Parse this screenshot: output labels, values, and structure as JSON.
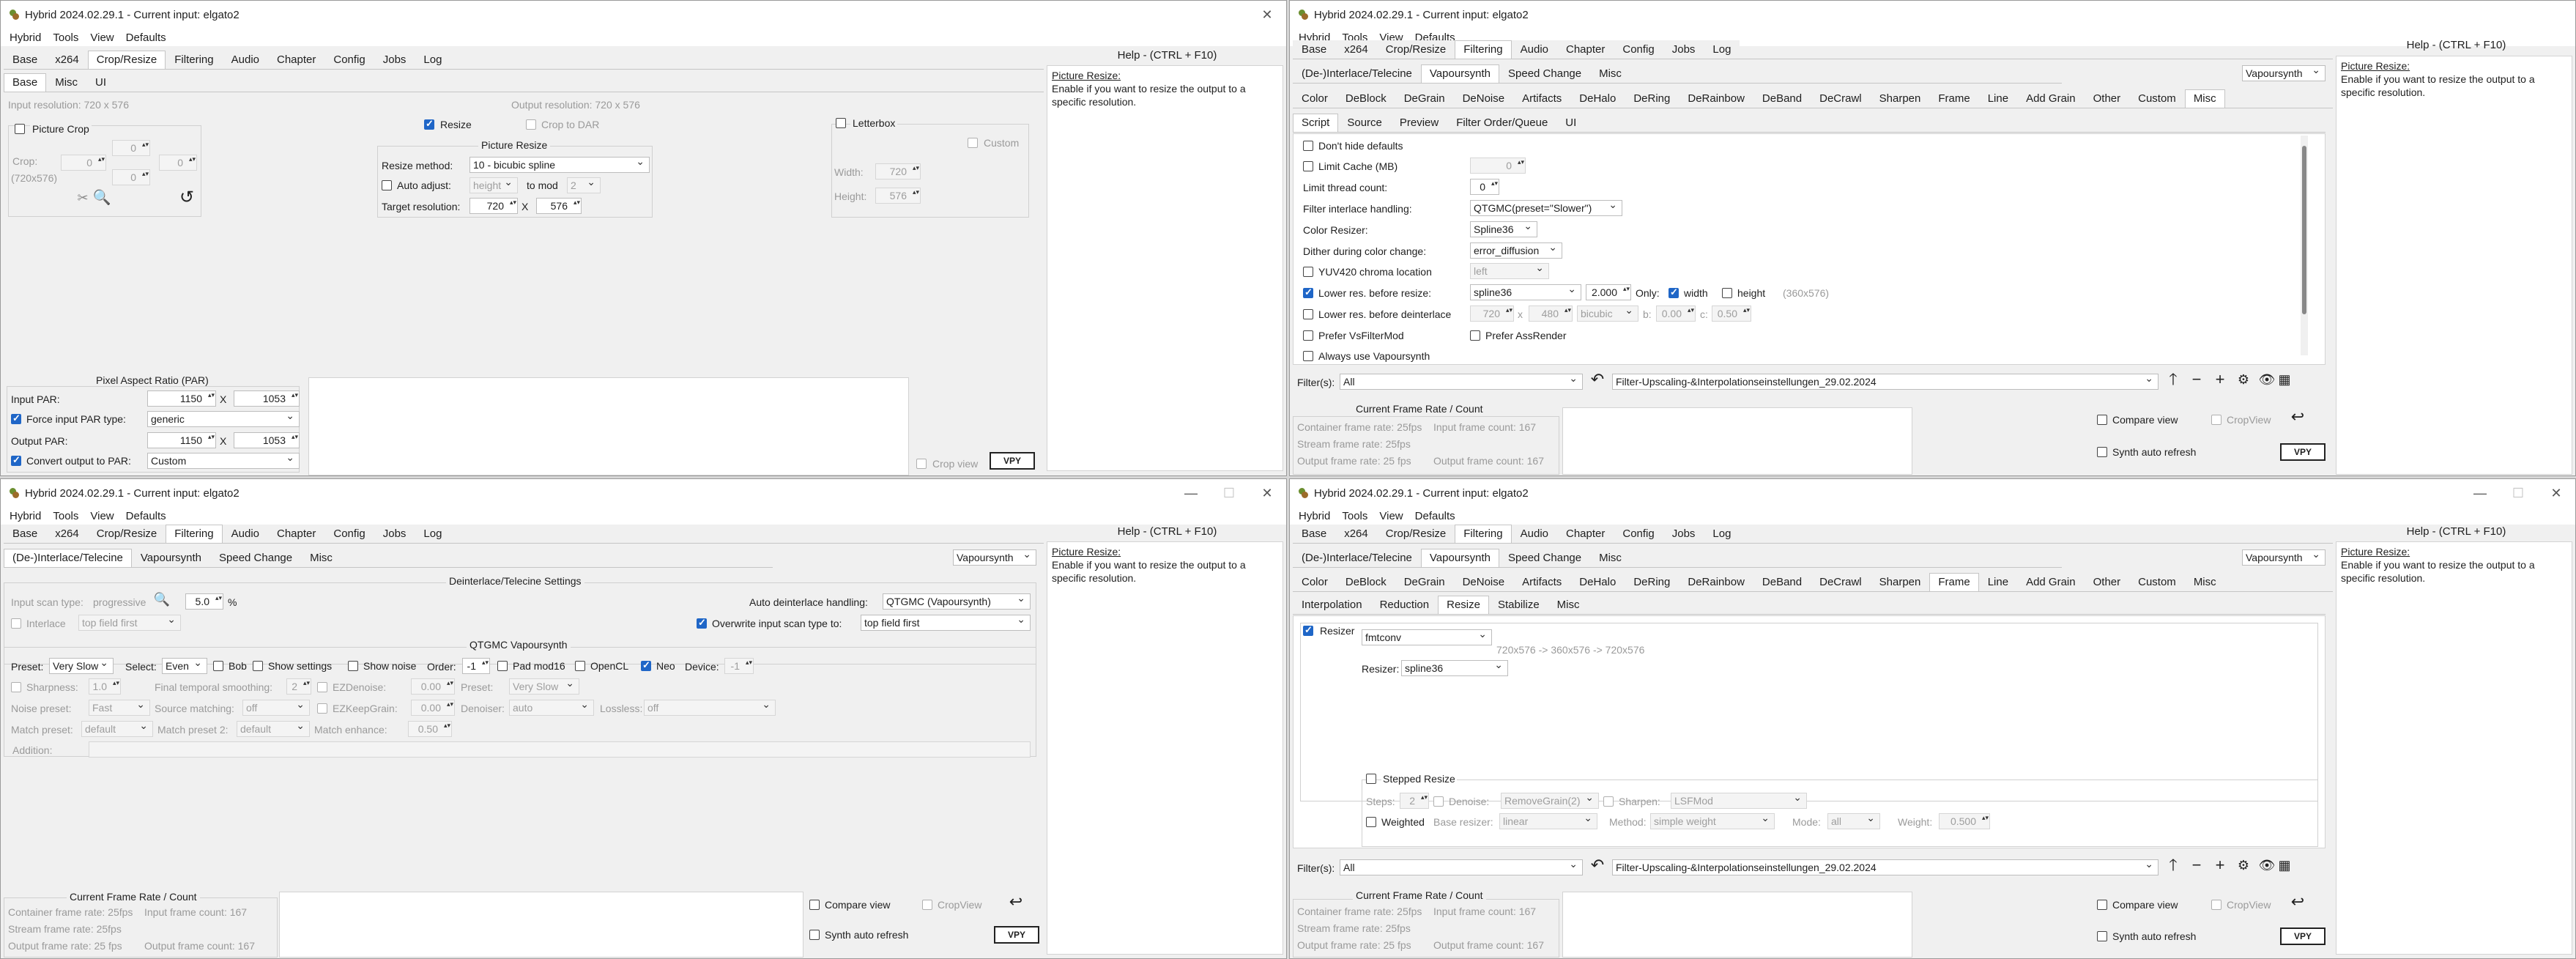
{
  "title": "Hybrid 2024.02.29.1 - Current input: elgato2",
  "menus": [
    "Hybrid",
    "Tools",
    "View",
    "Defaults"
  ],
  "main_tabs": [
    "Base",
    "x264",
    "Crop/Resize",
    "Filtering",
    "Audio",
    "Chapter",
    "Config",
    "Jobs",
    "Log"
  ],
  "help_title": "Help - (CTRL + F10)",
  "help_heading": "Picture Resize:",
  "help_text": "Enable if you want to resize the output to a specific resolution.",
  "w1": {
    "sub_tabs": [
      "Base",
      "Misc",
      "UI"
    ],
    "input_resolution": "Input resolution: 720 x 576",
    "output_resolution": "Output resolution: 720 x 576",
    "picture_crop": "Picture Crop",
    "crop_label": "Crop:",
    "crop_dims": "(720x576)",
    "crop_values": [
      "0",
      "0",
      "0",
      "0"
    ],
    "resize": "Resize",
    "crop_to_dar": "Crop to DAR",
    "picture_resize_title": "Picture Resize",
    "resize_method_label": "Resize method:",
    "resize_method": "10 - bicubic spline",
    "auto_adjust": "Auto adjust:",
    "auto_adjust_value": "height",
    "to_mod": "to mod",
    "mod_value": "2",
    "target_label": "Target resolution:",
    "target_w": "720",
    "x": "X",
    "target_h": "576",
    "letterbox": "Letterbox",
    "custom": "Custom",
    "width_label": "Width:",
    "width_value": "720",
    "height_label": "Height:",
    "height_value": "576",
    "par_title": "Pixel Aspect Ratio (PAR)",
    "input_par_label": "Input PAR:",
    "input_par": [
      "1150",
      "1053"
    ],
    "force_input_par": "Force input PAR type:",
    "force_input_par_value": "generic",
    "output_par_label": "Output PAR:",
    "output_par": [
      "1150",
      "1053"
    ],
    "convert_par": "Convert output to PAR:",
    "convert_par_value": "Custom",
    "crop_view": "Crop view"
  },
  "w2": {
    "filter_tabs": [
      "(De-)Interlace/Telecine",
      "Vapoursynth",
      "Speed Change",
      "Misc"
    ],
    "engine": "Vapoursynth",
    "vs_tabs": [
      "Color",
      "DeBlock",
      "DeGrain",
      "DeNoise",
      "Artifacts",
      "DeHalo",
      "DeRing",
      "DeRainbow",
      "DeBand",
      "DeCrawl",
      "Sharpen",
      "Frame",
      "Line",
      "Add Grain",
      "Other",
      "Custom",
      "Misc"
    ],
    "misc_tabs": [
      "Script",
      "Source",
      "Preview",
      "Filter Order/Queue",
      "UI"
    ],
    "dont_hide": "Don't hide defaults",
    "limit_cache": "Limit Cache (MB)",
    "limit_cache_value": "0",
    "limit_thread": "Limit thread count:",
    "limit_thread_value": "0",
    "interlace_handling_label": "Filter interlace handling:",
    "interlace_handling": "QTGMC(preset=\"Slower\")",
    "color_resizer_label": "Color Resizer:",
    "color_resizer": "Spline36",
    "dither_label": "Dither during color change:",
    "dither": "error_diffusion",
    "yuv420_label": "YUV420 chroma location",
    "yuv420": "left",
    "lower_resize": "Lower res. before resize:",
    "lower_resize_kernel": "spline36",
    "lower_resize_factor": "2.000",
    "only": "Only:",
    "width": "width",
    "height": "height",
    "lower_resize_dims": "(360x576)",
    "lower_deint": "Lower res. before deinterlace",
    "lower_deint_w": "720",
    "lower_deint_x": "x",
    "lower_deint_h": "480",
    "lower_deint_kernel": "bicubic",
    "b_label": "b:",
    "b_value": "0.00",
    "c_label": "c:",
    "c_value": "0.50",
    "prefer_vsfm": "Prefer VsFilterMod",
    "prefer_ass": "Prefer AssRender",
    "always_vs": "Always use Vapoursynth"
  },
  "filter_label": "Filter(s):",
  "filter_value": "All",
  "filter_preset": "Filter-Upscaling-&Interpolationseinstellungen_29.02.2024",
  "frame_title": "Current Frame Rate / Count",
  "container_rate": "Container frame rate: 25fps",
  "input_count": "Input frame count:   167",
  "stream_rate": "Stream frame rate:     25fps",
  "output_rate": "Output frame rate:     25 fps",
  "output_count": "Output frame count: 167",
  "compare_view": "Compare view",
  "crop_view": "CropView",
  "synth_refresh": "Synth auto refresh",
  "vpy": "VPY",
  "w3": {
    "deint_title": "Deinterlace/Telecine Settings",
    "scan_type_label": "Input scan type:",
    "scan_type": "progressive",
    "scan_percent": "5.0",
    "percent": "%",
    "interlace": "Interlace",
    "top_field": "top field first",
    "auto_deint_label": "Auto deinterlace handling:",
    "auto_deint": "QTGMC (Vapoursynth)",
    "overwrite_scan": "Overwrite input scan type to:",
    "overwrite_value": "top field first",
    "qtgmc_title": "QTGMC Vapoursynth",
    "preset_label": "Preset:",
    "preset": "Very Slow",
    "select_label": "Select:",
    "select": "Even",
    "bob": "Bob",
    "show_settings": "Show settings",
    "show_noise": "Show noise",
    "order_label": "Order:",
    "order": "-1",
    "pad_mod16": "Pad mod16",
    "opencl": "OpenCL",
    "neo": "Neo",
    "device_label": "Device:",
    "device": "-1",
    "sharpness": "Sharpness:",
    "sharpness_value": "1.0",
    "final_temporal": "Final temporal smoothing:",
    "final_temporal_value": "2",
    "ezdenoise": "EZDenoise:",
    "ezdenoise_value": "0.00",
    "preset2_label": "Preset:",
    "preset2": "Very Slow",
    "noise_preset_label": "Noise preset:",
    "noise_preset": "Fast",
    "source_matching_label": "Source matching:",
    "source_matching": "off",
    "ezkeepgrain": "EZKeepGrain:",
    "ezkeepgrain_value": "0.00",
    "denoiser_label": "Denoiser:",
    "denoiser": "auto",
    "lossless_label": "Lossless:",
    "lossless": "off",
    "match_preset_label": "Match preset:",
    "match_preset": "default",
    "match_preset2_label": "Match preset 2:",
    "match_preset2": "default",
    "match_enhance_label": "Match enhance:",
    "match_enhance": "0.50",
    "addition": "Addition:"
  },
  "w4": {
    "frame_tabs": [
      "Interpolation",
      "Reduction",
      "Resize",
      "Stabilize",
      "Misc"
    ],
    "resizer_check": "Resizer",
    "resizer_engine": "fmtconv",
    "resize_chain": "720x576 -> 360x576 -> 720x576",
    "resizer_label": "Resizer:",
    "resizer_value": "spline36",
    "stepped": "Stepped Resize",
    "steps_label": "Steps:",
    "steps": "2",
    "denoise_label": "Denoise:",
    "denoise": "RemoveGrain(2)",
    "sharpen_label": "Sharpen:",
    "sharpen": "LSFMod",
    "weighted": "Weighted",
    "base_resizer_label": "Base resizer:",
    "base_resizer": "linear",
    "method_label": "Method:",
    "method": "simple weight",
    "mode_label": "Mode:",
    "mode": "all",
    "weight_label": "Weight:",
    "weight": "0.500"
  }
}
